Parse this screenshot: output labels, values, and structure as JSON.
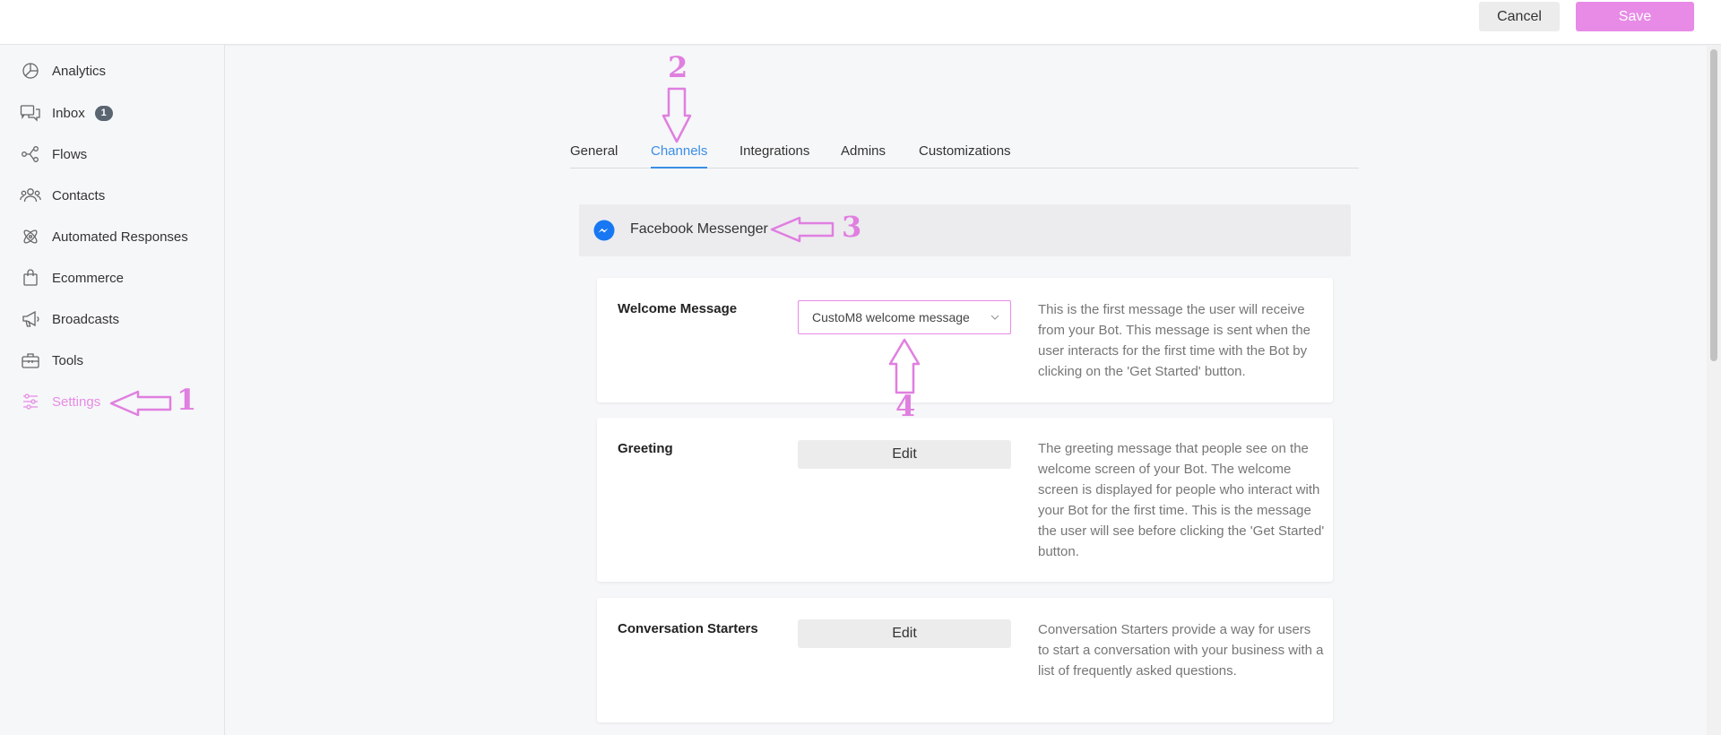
{
  "header": {
    "cancel_label": "Cancel",
    "save_label": "Save"
  },
  "sidebar": {
    "items": [
      {
        "label": "Analytics",
        "icon": "analytics-icon"
      },
      {
        "label": "Inbox",
        "icon": "inbox-icon",
        "badge": "1"
      },
      {
        "label": "Flows",
        "icon": "flows-icon"
      },
      {
        "label": "Contacts",
        "icon": "contacts-icon"
      },
      {
        "label": "Automated Responses",
        "icon": "automated-responses-icon"
      },
      {
        "label": "Ecommerce",
        "icon": "ecommerce-icon"
      },
      {
        "label": "Broadcasts",
        "icon": "broadcasts-icon"
      },
      {
        "label": "Tools",
        "icon": "tools-icon"
      },
      {
        "label": "Settings",
        "icon": "settings-icon",
        "active": true
      }
    ]
  },
  "tabs": [
    {
      "label": "General"
    },
    {
      "label": "Channels",
      "active": true
    },
    {
      "label": "Integrations"
    },
    {
      "label": "Admins"
    },
    {
      "label": "Customizations"
    }
  ],
  "channel": {
    "name": "Facebook Messenger",
    "icon": "messenger-icon"
  },
  "settings": {
    "welcome": {
      "label": "Welcome Message",
      "selected": "CustoM8 welcome message",
      "description": "This is the first message the user will receive from your Bot. This message is sent when the user interacts for the first time with the Bot by clicking on the 'Get Started' button."
    },
    "greeting": {
      "label": "Greeting",
      "button": "Edit",
      "description": "The greeting message that people see on the welcome screen of your Bot. The welcome screen is displayed for people who interact with your Bot for the first time. This is the message the user will see before clicking the 'Get Started' button."
    },
    "starters": {
      "label": "Conversation Starters",
      "button": "Edit",
      "description": "Conversation Starters provide a way for users to start a conversation with your business with a list of frequently asked questions."
    }
  },
  "annotations": {
    "a1": "1",
    "a2": "2",
    "a3": "3",
    "a4": "4"
  },
  "colors": {
    "accent": "#e78be6",
    "active_tab": "#3a8ee6",
    "badge": "#5b6572"
  }
}
